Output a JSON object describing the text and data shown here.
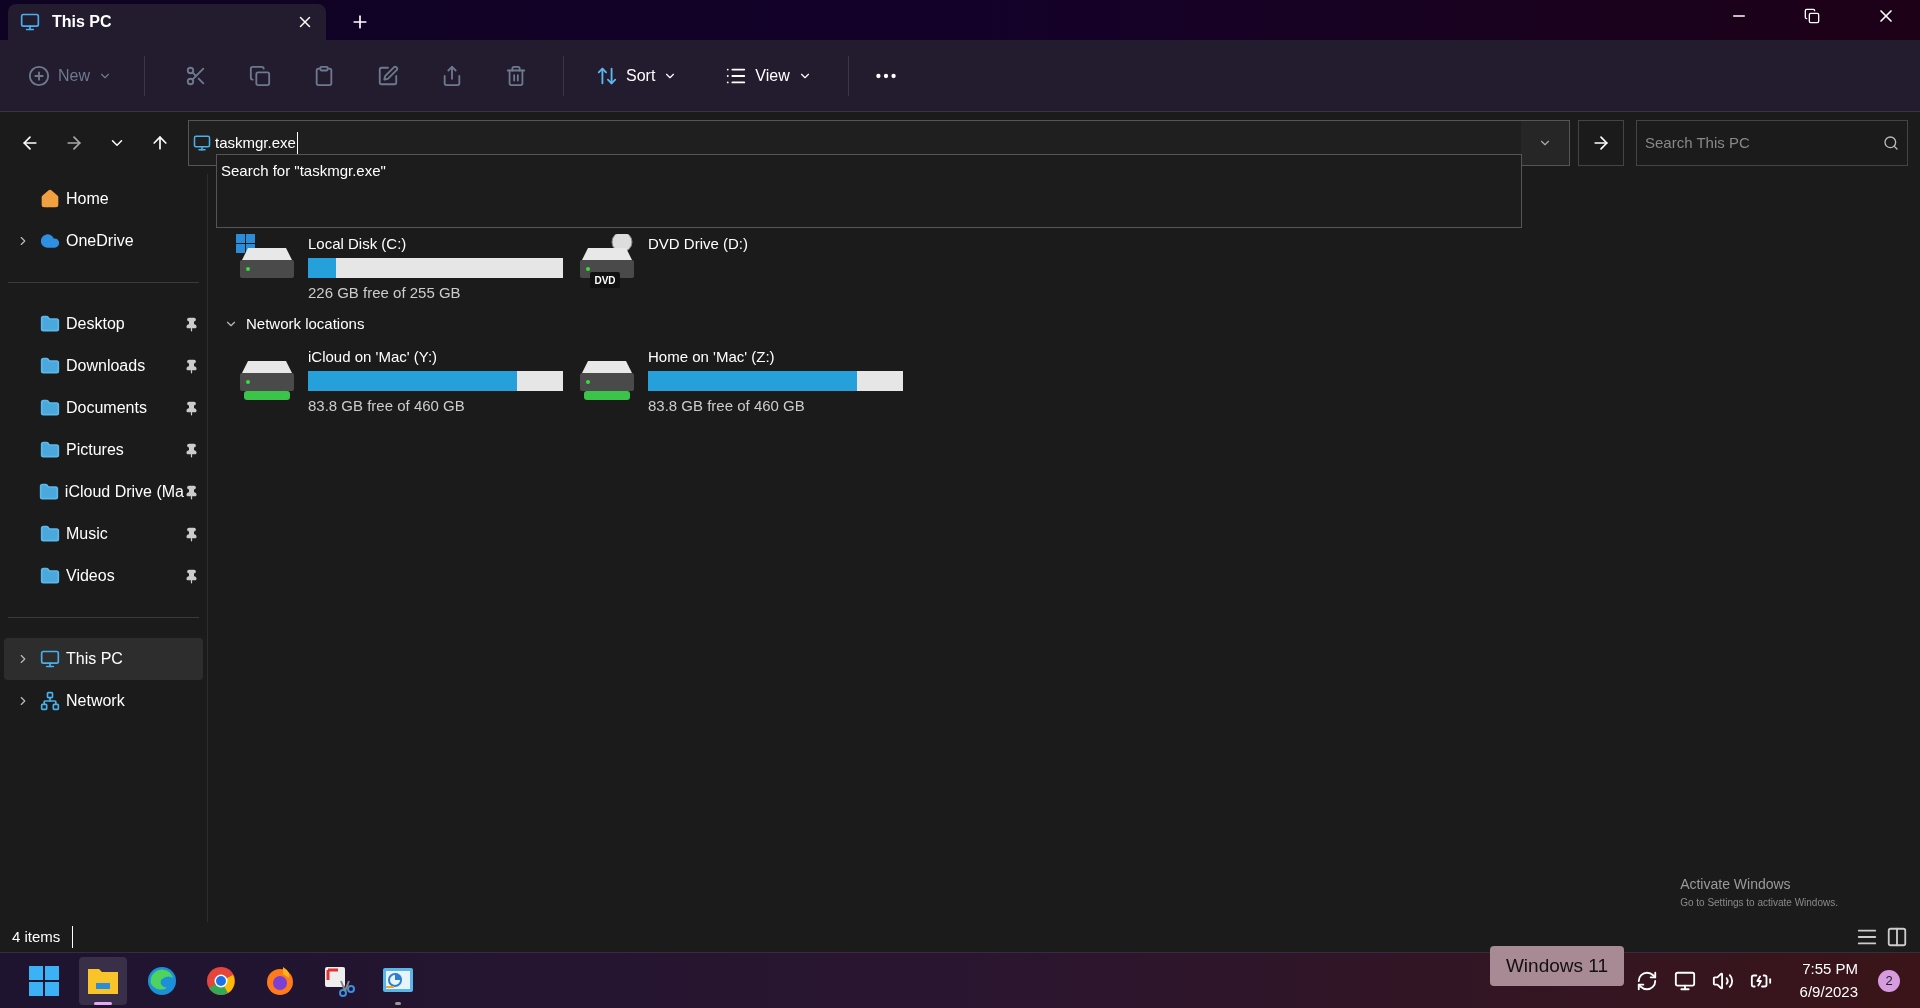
{
  "tabs": [
    {
      "title": "This PC",
      "selected": true
    }
  ],
  "toolbar": {
    "new": "New",
    "sort": "Sort",
    "view": "View"
  },
  "address": {
    "value": "taskmgr.exe",
    "suggestion": "Search for \"taskmgr.exe\""
  },
  "search": {
    "placeholder": "Search This PC"
  },
  "sidebar": {
    "top": [
      {
        "label": "Home",
        "kind": "home",
        "expandable": false,
        "selected": false
      },
      {
        "label": "OneDrive",
        "kind": "cloud",
        "expandable": true,
        "selected": false
      }
    ],
    "pinned": [
      {
        "label": "Desktop",
        "kind": "folder",
        "pinned": true,
        "selected": false
      },
      {
        "label": "Downloads",
        "kind": "folder",
        "pinned": true,
        "selected": false
      },
      {
        "label": "Documents",
        "kind": "folder",
        "pinned": true,
        "selected": false
      },
      {
        "label": "Pictures",
        "kind": "folder",
        "pinned": true,
        "selected": false
      },
      {
        "label": "iCloud Drive (Ma",
        "kind": "folder",
        "pinned": true,
        "selected": false
      },
      {
        "label": "Music",
        "kind": "folder",
        "pinned": true,
        "selected": false
      },
      {
        "label": "Videos",
        "kind": "folder",
        "pinned": true,
        "selected": false
      }
    ],
    "bottom": [
      {
        "label": "This PC",
        "kind": "pc",
        "expandable": true,
        "selected": true
      },
      {
        "label": "Network",
        "kind": "network",
        "expandable": true,
        "selected": false
      }
    ]
  },
  "drives": [
    {
      "name": "Local Disk (C:)",
      "kind": "disk",
      "level": 0.11,
      "free": "226 GB free of 255 GB"
    },
    {
      "name": "DVD Drive (D:)",
      "kind": "dvd",
      "dvd_label": "DVD"
    }
  ],
  "network_locations": {
    "title": "Network locations",
    "expanded": true,
    "drives": [
      {
        "name": "iCloud on 'Mac' (Y:)",
        "kind": "network",
        "level": 0.82,
        "free": "83.8 GB free of 460 GB"
      },
      {
        "name": "Home on 'Mac' (Z:)",
        "kind": "network",
        "level": 0.82,
        "free": "83.8 GB free of 460 GB"
      }
    ]
  },
  "status_bar": {
    "items": "4 items"
  },
  "activation": {
    "title": "Activate Windows",
    "text": "Go to Settings to activate Windows."
  },
  "taskbar": {
    "apps": [
      {
        "kind": "start",
        "running": false,
        "selected": false
      },
      {
        "kind": "explorer",
        "running": true,
        "selected": true
      },
      {
        "kind": "edge",
        "running": false,
        "selected": false
      },
      {
        "kind": "chrome",
        "running": false,
        "selected": false
      },
      {
        "kind": "firefox",
        "running": false,
        "selected": false
      },
      {
        "kind": "snip",
        "running": false,
        "selected": false
      },
      {
        "kind": "remote",
        "running": true,
        "selected": false
      }
    ],
    "tooltip": "Windows 11",
    "time": "7:55 PM",
    "date": "6/9/2023",
    "notifications": "2"
  }
}
